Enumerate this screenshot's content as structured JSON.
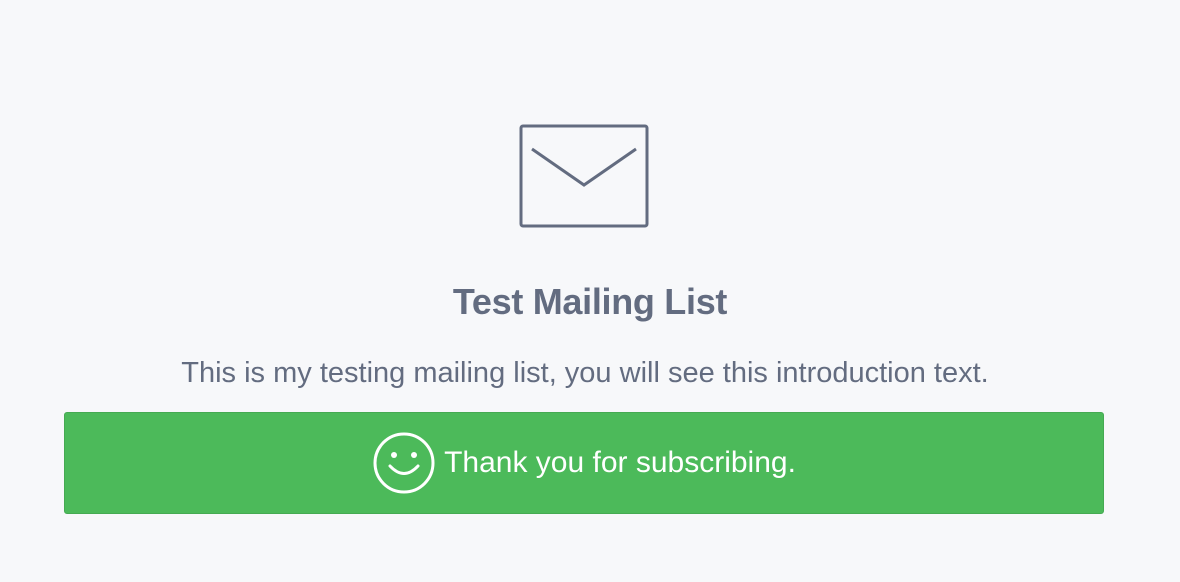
{
  "icons": {
    "main": "envelope-icon",
    "success": "smile-icon"
  },
  "colors": {
    "background": "#f7f8fa",
    "text": "#636c80",
    "success": "#4cba5a",
    "success_text": "#ffffff"
  },
  "list": {
    "title": "Test Mailing List",
    "intro": "This is my testing mailing list, you will see this introduction text."
  },
  "message": {
    "success": "Thank you for subscribing."
  }
}
